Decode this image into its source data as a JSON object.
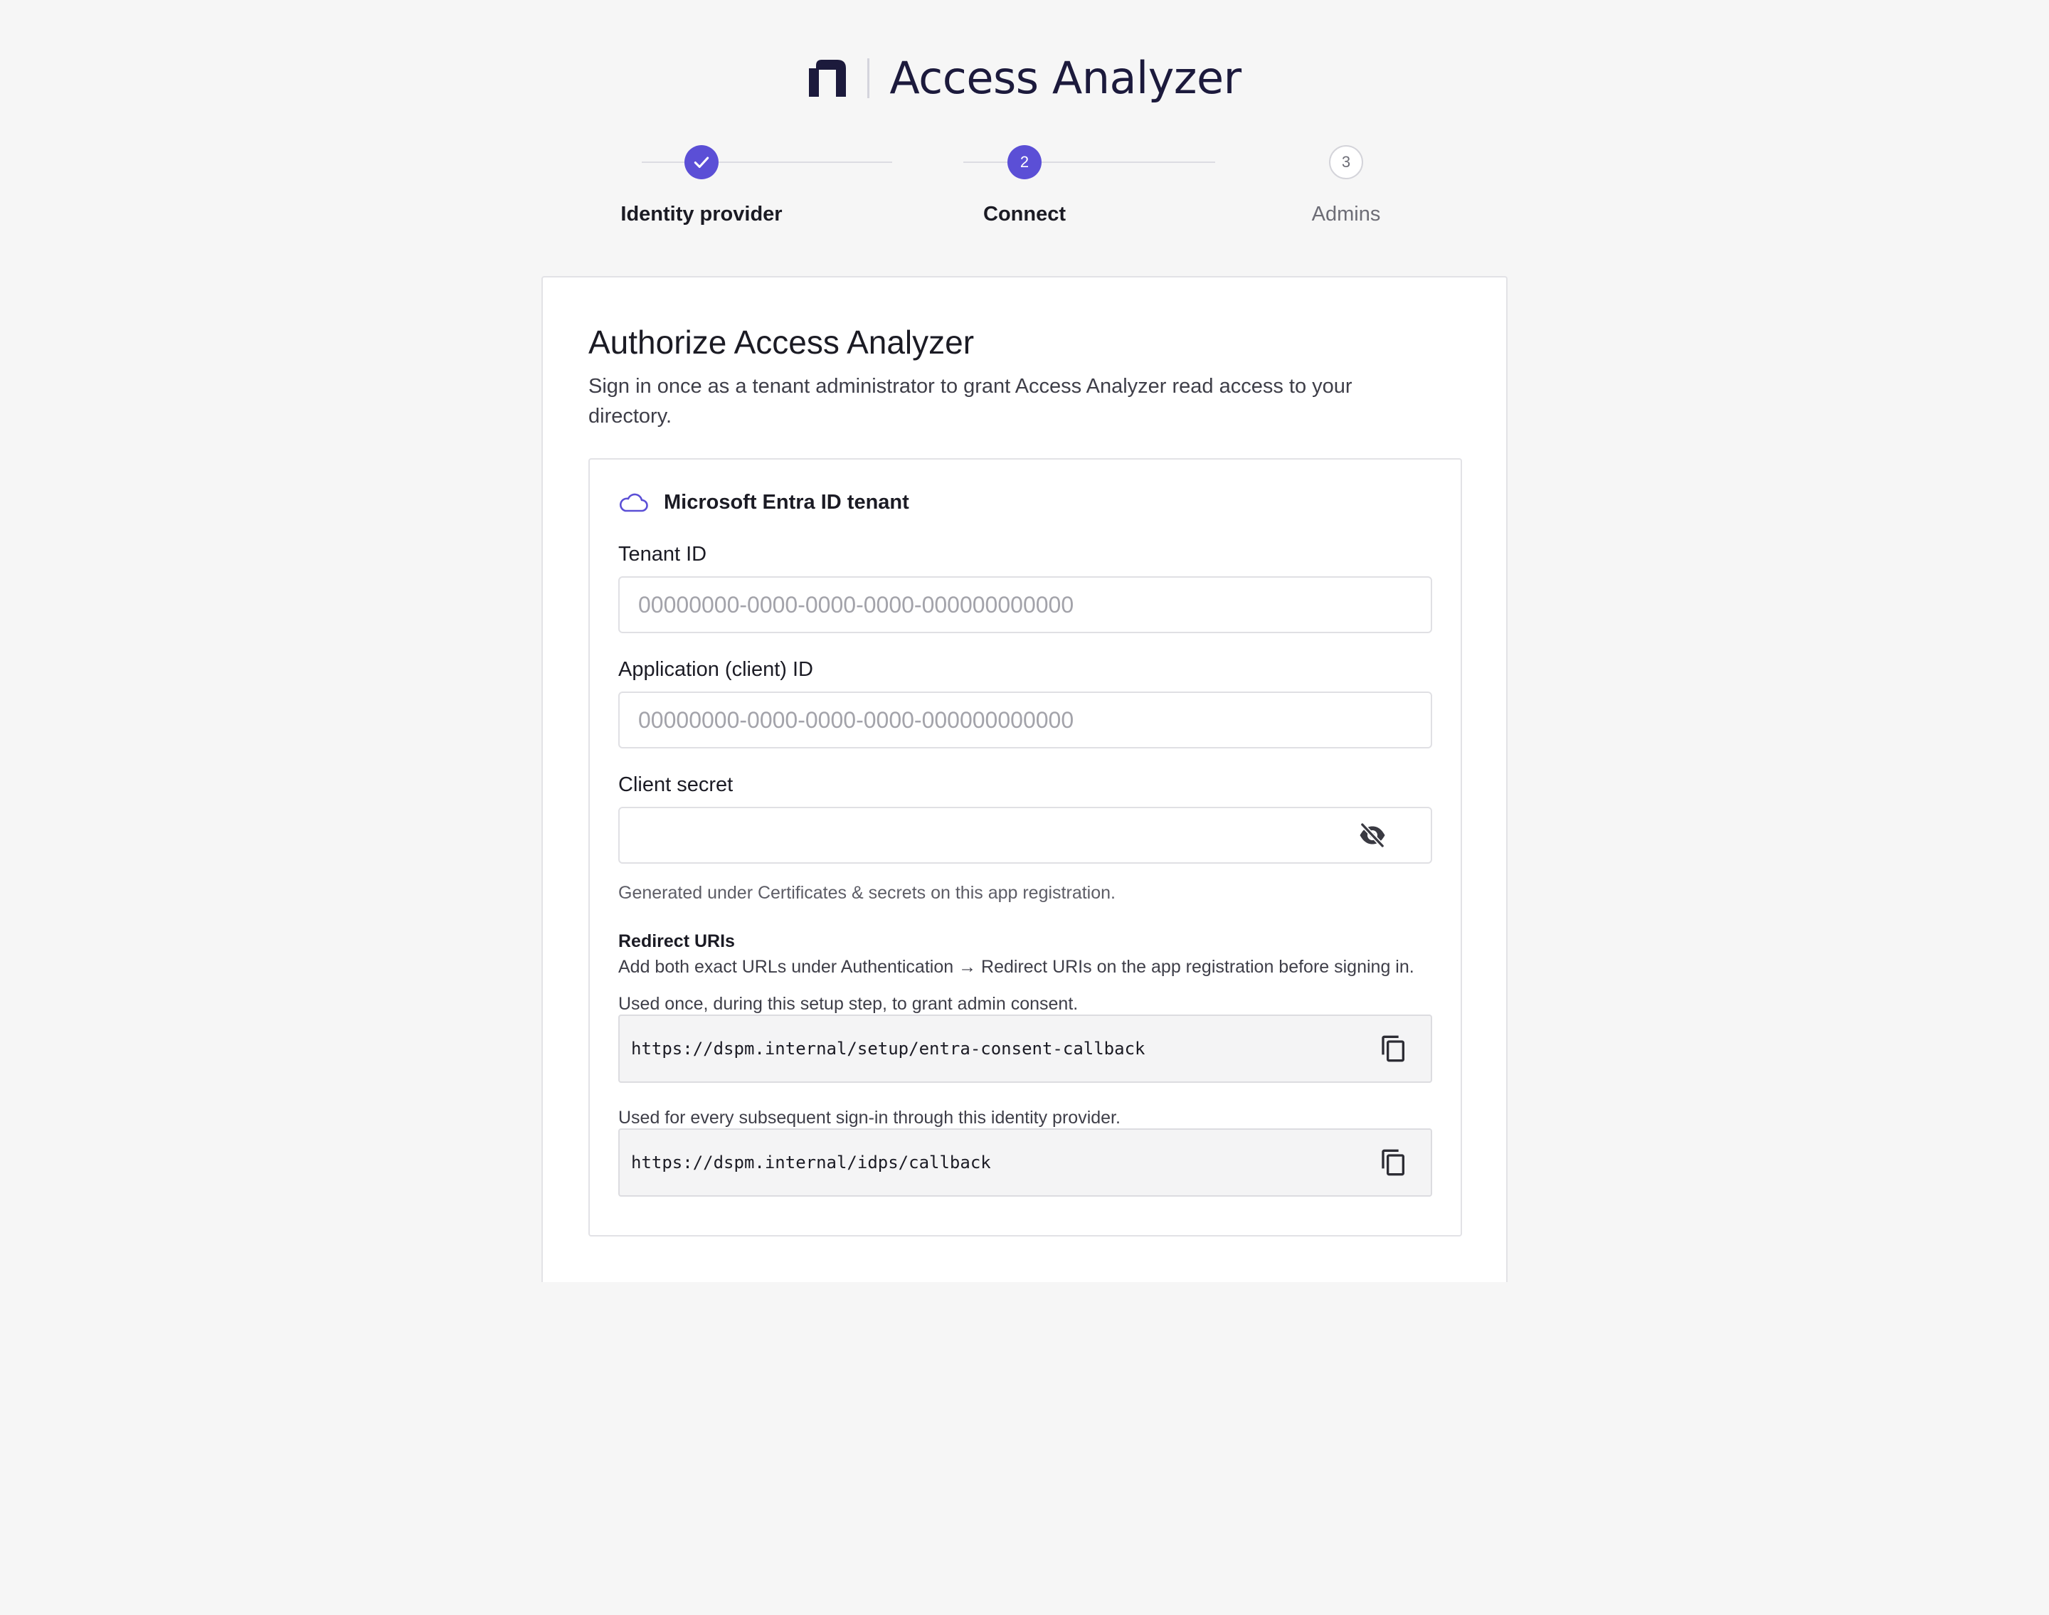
{
  "brand": {
    "title": "Access Analyzer",
    "logo_icon": "n-logo-icon",
    "logo_color": "#1c1a3c"
  },
  "stepper": {
    "steps": [
      {
        "number": "1",
        "label": "Identity provider",
        "state": "done"
      },
      {
        "number": "2",
        "label": "Connect",
        "state": "active"
      },
      {
        "number": "3",
        "label": "Admins",
        "state": "pending"
      }
    ],
    "accent_color": "#5b4fd6"
  },
  "card": {
    "title": "Authorize Access Analyzer",
    "description": "Sign in once as a tenant administrator to grant Access Analyzer read access to your directory."
  },
  "tenant_panel": {
    "icon": "cloud-icon",
    "title": "Microsoft Entra ID tenant",
    "tenant_id": {
      "label": "Tenant ID",
      "value": "",
      "placeholder": "00000000-0000-0000-0000-000000000000"
    },
    "client_id": {
      "label": "Application (client) ID",
      "value": "",
      "placeholder": "00000000-0000-0000-0000-000000000000"
    },
    "client_secret": {
      "label": "Client secret",
      "value": "",
      "visibility_icon": "eye-off-icon",
      "helper": "Generated under Certificates & secrets on this app registration."
    },
    "redirect_uris": {
      "heading": "Redirect URIs",
      "description": "Add both exact URLs under Authentication → Redirect URIs on the app registration before signing in.",
      "items": [
        {
          "caption": "Used once, during this setup step, to grant admin consent.",
          "uri": "https://dspm.internal/setup/entra-consent-callback",
          "copy_icon": "copy-icon"
        },
        {
          "caption": "Used for every subsequent sign-in through this identity provider.",
          "uri": "https://dspm.internal/idps/callback",
          "copy_icon": "copy-icon"
        }
      ]
    }
  }
}
